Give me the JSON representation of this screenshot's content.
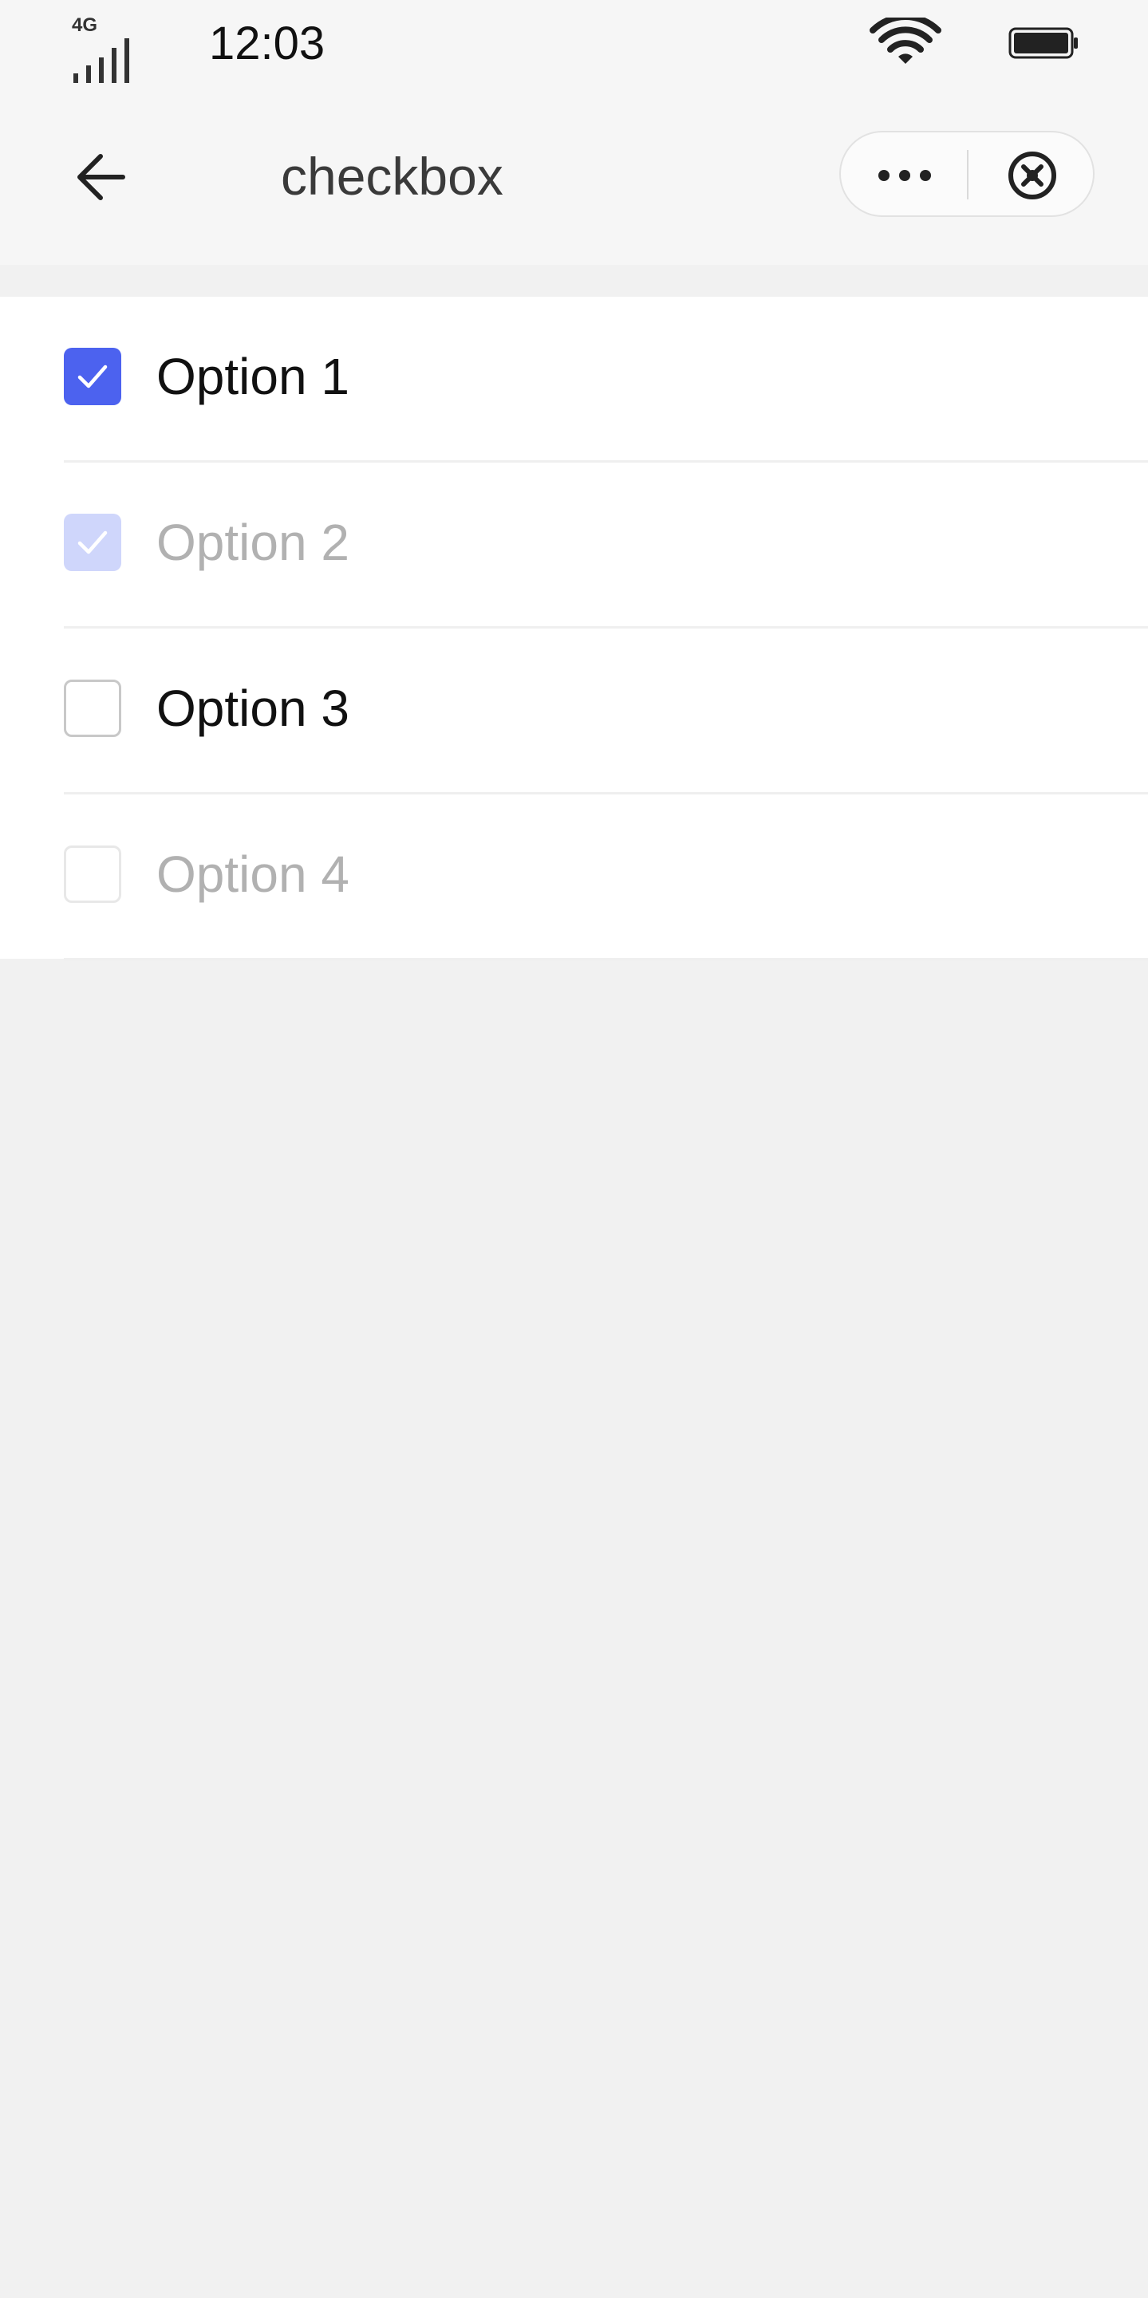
{
  "status_bar": {
    "network": "4G",
    "time": "12:03",
    "icons": [
      "signal-icon",
      "wifi-icon",
      "battery-icon"
    ]
  },
  "nav": {
    "title": "checkbox",
    "icons": [
      "back-icon",
      "more-icon",
      "close-icon"
    ]
  },
  "options": [
    {
      "label": "Option 1",
      "checked": true,
      "disabled": false
    },
    {
      "label": "Option 2",
      "checked": true,
      "disabled": true
    },
    {
      "label": "Option 3",
      "checked": false,
      "disabled": false
    },
    {
      "label": "Option 4",
      "checked": false,
      "disabled": true
    }
  ],
  "colors": {
    "accent": "#4c62ef",
    "accent_disabled": "#cfd6fb",
    "background": "#f1f1f1"
  }
}
